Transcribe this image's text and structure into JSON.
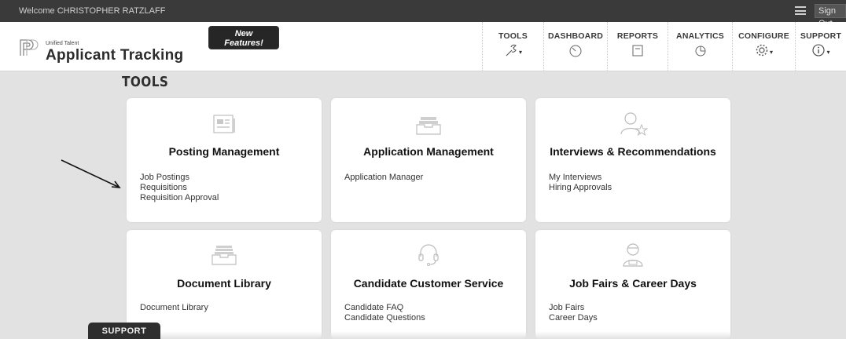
{
  "topbar": {
    "welcome": "Welcome CHRISTOPHER RATZLAFF",
    "menu_icon": "hamburger-menu-icon",
    "sign_out": "Sign Out"
  },
  "header": {
    "brand_small": "Unified Talent",
    "brand_big": "Applicant Tracking",
    "new_features_line1": "New",
    "new_features_line2": "Features!",
    "nav": [
      {
        "label": "TOOLS",
        "icon": "wrench-icon"
      },
      {
        "label": "DASHBOARD",
        "icon": "gauge-icon"
      },
      {
        "label": "REPORTS",
        "icon": "report-icon"
      },
      {
        "label": "ANALYTICS",
        "icon": "pie-chart-icon"
      },
      {
        "label": "CONFIGURE",
        "icon": "gear-icon"
      },
      {
        "label": "SUPPORT",
        "icon": "info-icon"
      }
    ]
  },
  "main": {
    "title": "TOOLS",
    "cards": [
      {
        "title": "Posting Management",
        "icon": "newspaper-icon",
        "links": [
          "Job Postings",
          "Requisitions",
          "Requisition Approval"
        ]
      },
      {
        "title": "Application Management",
        "icon": "inbox-tray-icon",
        "links": [
          "Application Manager"
        ]
      },
      {
        "title": "Interviews & Recommendations",
        "icon": "user-star-icon",
        "links": [
          "My Interviews",
          "Hiring Approvals"
        ]
      },
      {
        "title": "Document Library",
        "icon": "document-tray-icon",
        "links": [
          "Document Library"
        ]
      },
      {
        "title": "Candidate Customer Service",
        "icon": "headset-icon",
        "links": [
          "Candidate FAQ",
          "Candidate Questions"
        ]
      },
      {
        "title": "Job Fairs & Career Days",
        "icon": "person-badge-icon",
        "links": [
          "Job Fairs",
          "Career Days"
        ]
      }
    ]
  },
  "support_tab": "SUPPORT",
  "colors": {
    "topbar": "#3a3a3a",
    "background": "#e2e2e2",
    "card": "#ffffff"
  }
}
